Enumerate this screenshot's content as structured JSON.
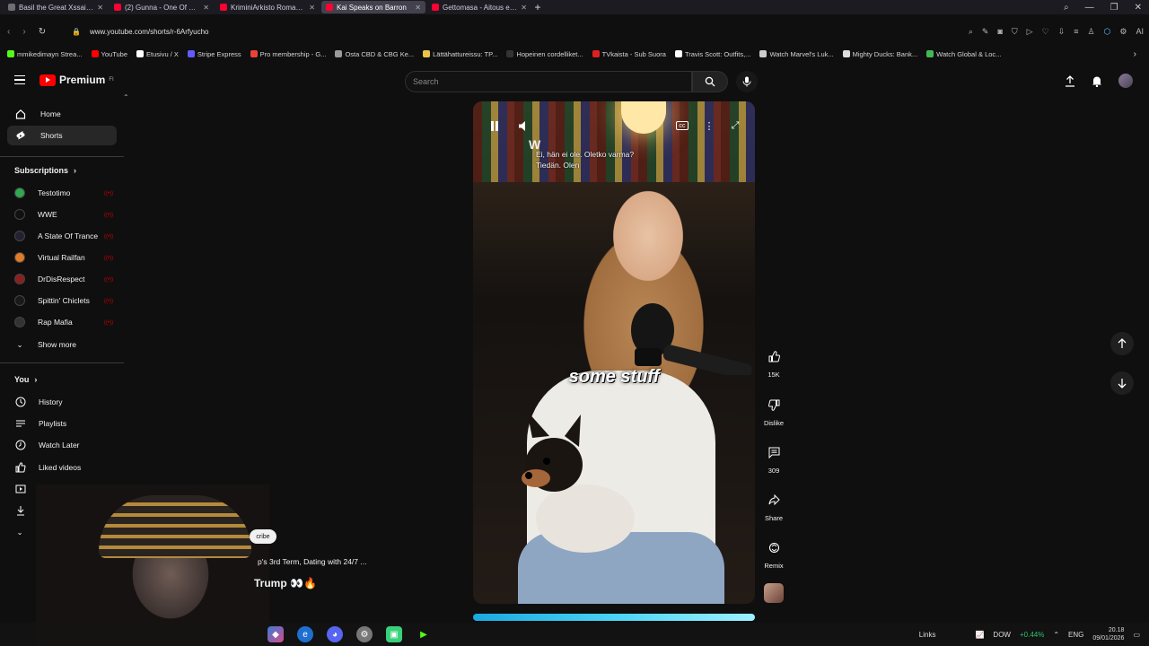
{
  "browser": {
    "tabs": [
      {
        "title": "Basil the Great Xssai: \"You",
        "color": "#6e6e73",
        "active": false
      },
      {
        "title": "(2) Gunna - One Of One Tonig",
        "color": "#ff0033",
        "active": false
      },
      {
        "title": "KriminiArkisto Romanian R",
        "color": "#ff0033",
        "active": false
      },
      {
        "title": "Kai Speaks on Barron",
        "color": "#ff0033",
        "active": true
      },
      {
        "title": "Gettomasa - Aitous ei oo",
        "color": "#ff0033",
        "active": false
      }
    ],
    "url": "www.youtube.com/shorts/r-6Arfyucho",
    "bookmarks": [
      {
        "label": "mmikedimayn Strea...",
        "color": "#53fc18"
      },
      {
        "label": "YouTube",
        "color": "#ff0000"
      },
      {
        "label": "Etusivu / X",
        "color": "#ffffff"
      },
      {
        "label": "Stripe Express",
        "color": "#635bff"
      },
      {
        "label": "Pro membership - G...",
        "color": "#ea4335"
      },
      {
        "label": "Osta CBD & CBG Ke...",
        "color": "#9a9a9a"
      },
      {
        "label": "Lättähattureissu: TP...",
        "color": "#e8c547"
      },
      {
        "label": "Hopeinen cordelliket...",
        "color": "#333333"
      },
      {
        "label": "TVkaista - Sub Suora",
        "color": "#e02020"
      },
      {
        "label": "Travis Scott: Outfits,...",
        "color": "#ffffff"
      },
      {
        "label": "Watch Marvel's Luk...",
        "color": "#cccccc"
      },
      {
        "label": "Mighty Ducks: Bank...",
        "color": "#dddddd"
      },
      {
        "label": "Watch Global & Loc...",
        "color": "#41b853"
      }
    ]
  },
  "header": {
    "logo_text": "Premium",
    "logo_badge": "FI",
    "search_placeholder": "Search"
  },
  "sidebar": {
    "nav": [
      {
        "label": "Home",
        "icon": "home-icon"
      },
      {
        "label": "Shorts",
        "icon": "shorts-icon",
        "active": true
      }
    ],
    "subscriptions_heading": "Subscriptions",
    "subscriptions": [
      {
        "name": "Testotimo",
        "color": "#2fa84f"
      },
      {
        "name": "WWE",
        "color": "#111111"
      },
      {
        "name": "A State Of Trance",
        "color": "#222233"
      },
      {
        "name": "Virtual Railfan",
        "color": "#e07b2a"
      },
      {
        "name": "DrDisRespect",
        "color": "#8a1f1f"
      },
      {
        "name": "Spittin' Chiclets",
        "color": "#1a1a1a"
      },
      {
        "name": "Rap Mafia",
        "color": "#333333"
      }
    ],
    "show_more": "Show more",
    "you_heading": "You",
    "you_items": [
      {
        "label": "History"
      },
      {
        "label": "Playlists"
      },
      {
        "label": "Watch Later"
      },
      {
        "label": "Liked videos"
      },
      {
        "label": "Your videos"
      },
      {
        "label": "D"
      }
    ]
  },
  "short": {
    "caption": "some stuff",
    "cc_line1": "Ei, hän ei ole. Oletko varma?",
    "cc_line2": "Tiedän. Olen",
    "actions": [
      {
        "label": "15K",
        "icon": "thumbs-up-icon"
      },
      {
        "label": "Dislike",
        "icon": "thumbs-down-icon"
      },
      {
        "label": "309",
        "icon": "comments-icon"
      },
      {
        "label": "Share",
        "icon": "share-icon"
      },
      {
        "label": "Remix",
        "icon": "remix-icon"
      }
    ]
  },
  "overlay": {
    "subscribe_chip": "cribe",
    "title_line": "p's 3rd Term, Dating with 24/7 ...",
    "title_bold": "Trump 👀🔥"
  },
  "taskbar": {
    "links_label": "Links",
    "stock_ticker": "DOW",
    "stock_change": "+0.44%",
    "lang": "ENG",
    "time": "20.18",
    "date": "09/01/2026"
  }
}
